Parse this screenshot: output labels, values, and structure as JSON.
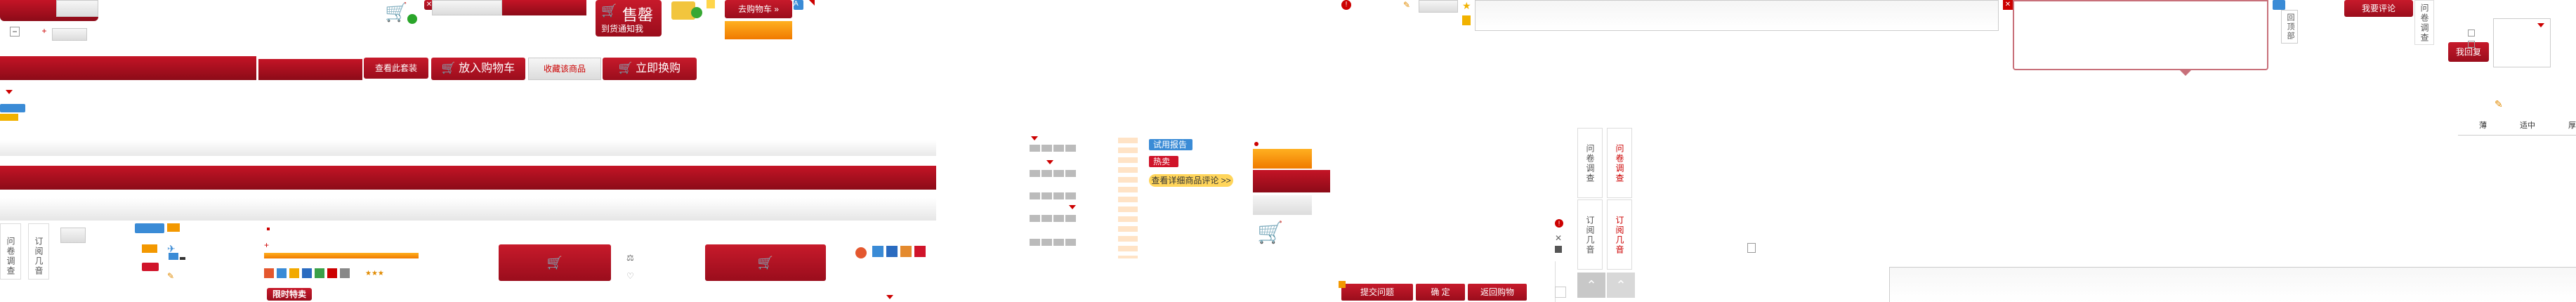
{
  "toolbar": {
    "sell_label": "售罄",
    "sell_sub": "到货通知我",
    "goto_cart_label": "去购物车 »",
    "view_set_label": "查看此套装",
    "add_to_cart_label": "放入购物车",
    "favorite_label": "收藏该商品",
    "buy_now_label": "立即换购"
  },
  "side_tabs": {
    "survey_label": "问卷调查",
    "subscribe_label": "订阅几音",
    "survey_label_2": "问卷调查",
    "subscribe_label_2": "订阅几音",
    "survey_label_3": "问卷调查",
    "back_to_top_label": "回顶部"
  },
  "tags": {
    "trial_report": "试用报告",
    "hot": "热卖",
    "view_review": "查看详细商品评论 >>"
  },
  "promo": {
    "limited_time": "限时特卖"
  },
  "comment": {
    "write_review_label": "我要评论",
    "reply_label": "我回复"
  },
  "form": {
    "submit_question_label": "提交问题",
    "confirm_label": "确 定",
    "back_shopping_label": "返回购物"
  },
  "misc": {
    "col_thin": "薄",
    "col_medium": "适中",
    "col_thick": "厚"
  },
  "colors": {
    "brand_red": "#b10d1f",
    "accent_orange": "#f39800",
    "link_blue": "#3a8bd6"
  }
}
